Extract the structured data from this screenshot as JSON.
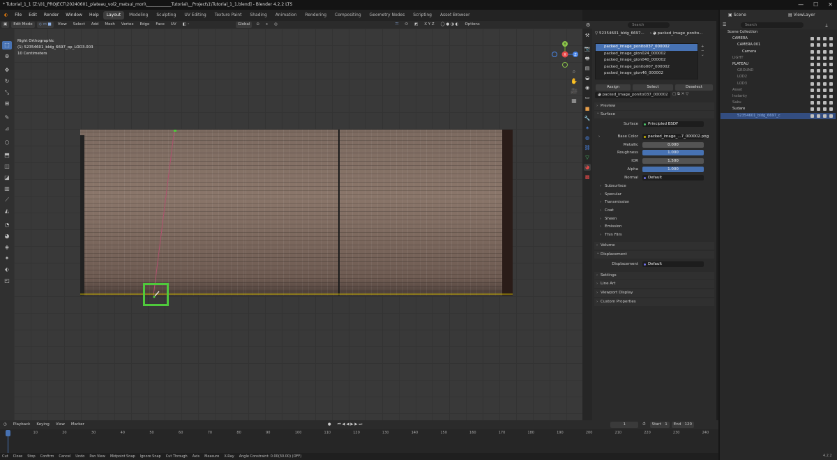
{
  "title_bar": {
    "text": "* Tutorial_1_1 [Z:\\01_PROJECT\\20240601_plateau_vol2_matsui_mori\\____________Tutorial\\__Project\\1\\Tutorial_1_1.blend] - Blender 4.2.2 LTS",
    "minimize": "—",
    "maximize": "☐",
    "close": "✕"
  },
  "menu": [
    "File",
    "Edit",
    "Render",
    "Window",
    "Help"
  ],
  "workspaces": [
    "Layout",
    "Modeling",
    "Sculpting",
    "UV Editing",
    "Texture Paint",
    "Shading",
    "Animation",
    "Rendering",
    "Compositing",
    "Geometry Nodes",
    "Scripting",
    "Asset Browser"
  ],
  "active_workspace": "Layout",
  "viewport_header": {
    "mode": "Edit Mode",
    "menus": [
      "View",
      "Select",
      "Add",
      "Mesh",
      "Vertex",
      "Edge",
      "Face",
      "UV"
    ],
    "transform": "Global",
    "options": "Options"
  },
  "viewport_info": {
    "view": "Right Orthographic",
    "object": "(1) 52354601_bldg_6697_op_LOD3.003",
    "scale": "10 Centimeters"
  },
  "gizmo": {
    "x": "X",
    "y": "Y",
    "z": "Z"
  },
  "properties": {
    "search_placeholder": "Search",
    "breadcrumb_object": "52354601_bldg_6697...",
    "breadcrumb_material": "packed_image_ponito...",
    "materials": [
      "packed_image_ponito037_000002",
      "packed_image_gion024_000002",
      "packed_image_gion040_000002",
      "packed_image_ponito007_000002",
      "packed_image_gion46_000002"
    ],
    "assign": "Assign",
    "select": "Select",
    "deselect": "Deselect",
    "active_material": "packed_image_ponito037_000002",
    "sections": {
      "preview": "Preview",
      "surface": "Surface",
      "volume": "Volume",
      "displacement": "Displacement",
      "settings": "Settings",
      "line_art": "Line Art",
      "viewport_display": "Viewport Display",
      "custom_properties": "Custom Properties"
    },
    "surface_label": "Surface",
    "surface_value": "Principled BSDF",
    "base_color_label": "Base Color",
    "base_color_value": "packed_image_...7_000002.png",
    "metallic_label": "Metallic",
    "metallic": "0.000",
    "roughness_label": "Roughness",
    "roughness": "1.000",
    "ior_label": "IOR",
    "ior": "1.500",
    "alpha_label": "Alpha",
    "alpha": "1.000",
    "normal_label": "Normal",
    "normal": "Default",
    "subpanels": [
      "Subsurface",
      "Specular",
      "Transmission",
      "Coat",
      "Sheen",
      "Emission",
      "Thin Film"
    ],
    "disp_label": "Displacement",
    "disp_value": "Default"
  },
  "outliner": {
    "scene": "Scene",
    "viewlayer": "ViewLayer",
    "search_placeholder": "Search",
    "rows": [
      {
        "label": "Scene Collection",
        "indent": 0
      },
      {
        "label": "CAMERA",
        "indent": 1
      },
      {
        "label": "CAMERA.001",
        "indent": 2
      },
      {
        "label": "Camera",
        "indent": 3
      },
      {
        "label": "LIGHT",
        "indent": 1
      },
      {
        "label": "PLATEAU",
        "indent": 1
      },
      {
        "label": "GROUND",
        "indent": 2
      },
      {
        "label": "LOD2",
        "indent": 2
      },
      {
        "label": "LOD3",
        "indent": 2
      },
      {
        "label": "Asset",
        "indent": 1
      },
      {
        "label": "Instanty",
        "indent": 1
      },
      {
        "label": "Saku",
        "indent": 1
      },
      {
        "label": "Sudare",
        "indent": 1
      },
      {
        "label": "52354601_bldg_6697_c",
        "indent": 2
      }
    ]
  },
  "timeline": {
    "menus": [
      "Playback",
      "Keying",
      "View",
      "Marker"
    ],
    "current": "1",
    "start_label": "Start",
    "start": "1",
    "end_label": "End",
    "end": "120",
    "frames": [
      "1",
      "10",
      "20",
      "30",
      "40",
      "50",
      "60",
      "70",
      "80",
      "90",
      "100",
      "110",
      "120",
      "130",
      "140",
      "150",
      "160",
      "170",
      "180",
      "190",
      "200",
      "210",
      "220",
      "230",
      "240"
    ]
  },
  "status": [
    "Cut",
    "Close",
    "Stop",
    "Confirm",
    "Cancel",
    "Undo",
    "Pan View",
    "Midpoint Snap",
    "Ignore Snap",
    "Cut Through",
    "Axis",
    "Measure",
    "X-Ray",
    "Angle Constraint: 0.00(30.00) (OFF)"
  ],
  "version": "4.2.2"
}
